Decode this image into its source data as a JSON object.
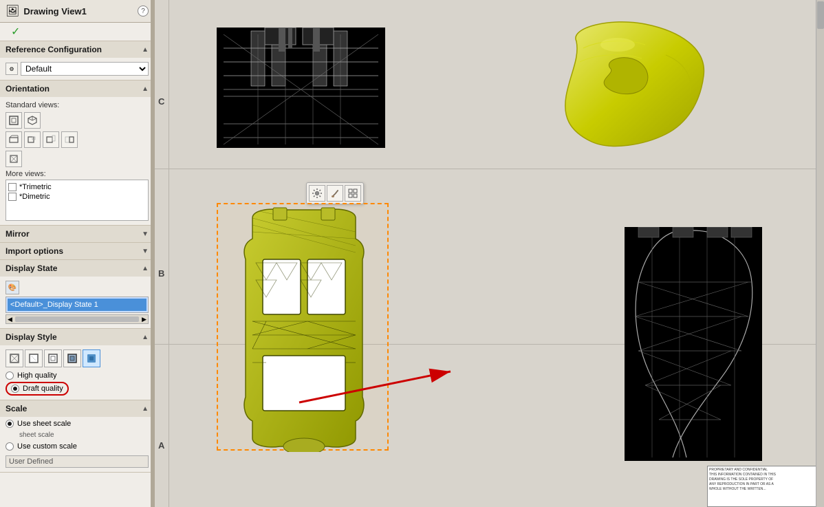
{
  "panel": {
    "title": "Drawing View1",
    "help_label": "?",
    "checkmark": "✓"
  },
  "reference_config": {
    "section_label": "Reference Configuration",
    "selected_value": "Default",
    "chevron": "▲"
  },
  "orientation": {
    "section_label": "Orientation",
    "standard_views_label": "Standard views:",
    "more_views_label": "More views:",
    "more_views_items": [
      "*Trimetric",
      "*Dimetric"
    ],
    "chevron": "▲"
  },
  "mirror": {
    "section_label": "Mirror",
    "chevron": "▼"
  },
  "import_options": {
    "section_label": "Import options",
    "chevron": "▼"
  },
  "display_state": {
    "section_label": "Display State",
    "items": [
      "<Default>_Display State 1"
    ],
    "selected_index": 0,
    "chevron": "▲",
    "scroll_left": "◀",
    "scroll_right": "▶"
  },
  "display_style": {
    "section_label": "Display Style",
    "chevron": "▲",
    "quality_options": [
      "High quality",
      "Draft quality"
    ],
    "selected_quality": 1
  },
  "scale": {
    "section_label": "Scale",
    "chevron": "▲",
    "options": [
      "Use sheet scale",
      "Use custom scale"
    ],
    "selected_option": 0,
    "sheet_scale_label": "sheet scale",
    "user_defined_label": "User Defined"
  },
  "drawing": {
    "row_labels": [
      "C",
      "B",
      "A"
    ],
    "row_label_positions": [
      145,
      415,
      685
    ],
    "title_block_text": "PROPRIETARY AND CONFIDENTIAL\nTHIS INFORMATION CONTAINED IN THIS\nDRAWING IS THE SOLE PROPERTY OF..."
  },
  "toolbar": {
    "buttons": [
      "gear",
      "brush",
      "grid"
    ]
  },
  "colors": {
    "selected_highlight": "#4a90d9",
    "orange_border": "#ff8800",
    "red_arrow": "#cc0000",
    "panel_bg": "#f0ede8",
    "section_header_bg": "#e0dbd0",
    "canvas_bg": "#d0ccc4",
    "yellow_part": "#c8cc00"
  }
}
